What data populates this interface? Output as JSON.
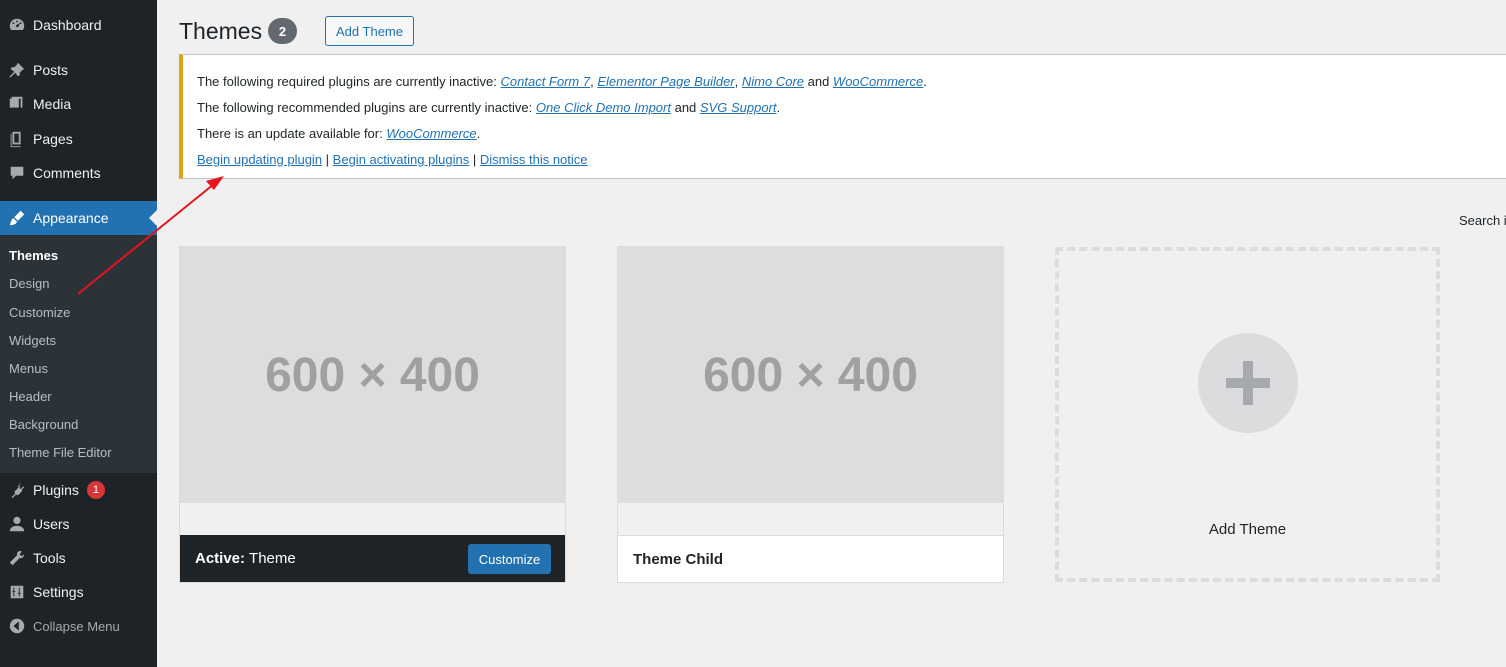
{
  "sidebar": {
    "menu": [
      {
        "label": "Dashboard",
        "icon": "dashboard-icon"
      },
      {
        "label": "Posts",
        "icon": "pin-icon"
      },
      {
        "label": "Media",
        "icon": "media-icon"
      },
      {
        "label": "Pages",
        "icon": "pages-icon"
      },
      {
        "label": "Comments",
        "icon": "comment-icon"
      },
      {
        "label": "Appearance",
        "icon": "brush-icon"
      }
    ],
    "submenu": [
      "Themes",
      "Design",
      "Customize",
      "Widgets",
      "Menus",
      "Header",
      "Background",
      "Theme File Editor"
    ],
    "menu_bottom": [
      {
        "label": "Plugins",
        "icon": "plugin-icon",
        "badge": "1"
      },
      {
        "label": "Users",
        "icon": "user-icon"
      },
      {
        "label": "Tools",
        "icon": "wrench-icon"
      },
      {
        "label": "Settings",
        "icon": "settings-icon"
      }
    ],
    "collapse_label": "Collapse Menu"
  },
  "header": {
    "title": "Themes",
    "count": "2",
    "add_button": "Add Theme"
  },
  "notice": {
    "line1_prefix": "The following required plugins are currently inactive: ",
    "line1_links": [
      "Contact Form 7",
      "Elementor Page Builder",
      "Nimo Core",
      "WooCommerce"
    ],
    "line1_sep1": ", ",
    "line1_sep2": ", ",
    "line1_and": " and ",
    "line1_end": ".",
    "line2_prefix": "The following recommended plugins are currently inactive: ",
    "line2_links": [
      "One Click Demo Import",
      "SVG Support"
    ],
    "line2_and": " and ",
    "line2_end": ".",
    "line3_prefix": "There is an update available for: ",
    "line3_link": "WooCommerce",
    "line3_end": ".",
    "actions": [
      "Begin updating plugin",
      "Begin activating plugins",
      "Dismiss this notice"
    ],
    "action_sep": " | "
  },
  "search_label": "Search in",
  "themes": [
    {
      "screenshot_text": "600 × 400",
      "active_prefix": "Active:",
      "name": " Theme",
      "customize": "Customize"
    },
    {
      "screenshot_text": "600 × 400",
      "name": "Theme Child"
    }
  ],
  "add_new": {
    "label": "Add Theme"
  },
  "colors": {
    "accent": "#2271b1",
    "sidebar": "#1d2327",
    "notice_border": "#dba617",
    "badge": "#d63638",
    "arrow": "#e8141c"
  }
}
